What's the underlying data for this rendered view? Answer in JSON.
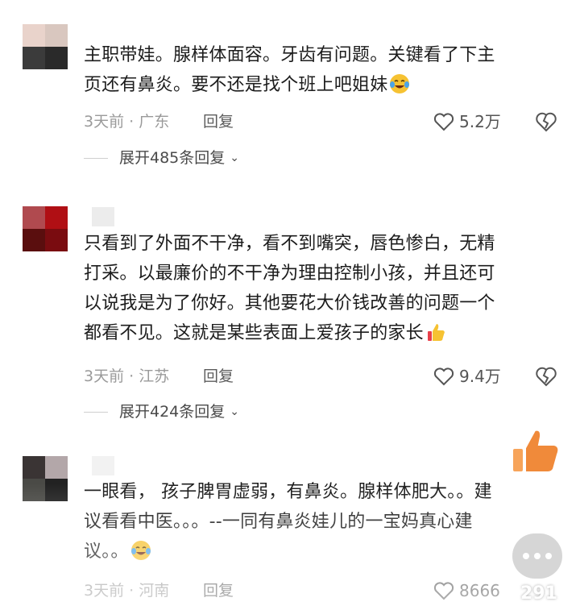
{
  "comments": [
    {
      "text_lines": [
        "主职带娃。腺样体面容。牙齿有问题。关键看了下主",
        "页还有鼻炎。要不还是找个班上吧姐妹"
      ],
      "emoji": "crying-laughing-emoji",
      "time_location": "3天前 · 广东",
      "reply_label": "回复",
      "likes": "5.2万",
      "expand_label": "展开485条回复",
      "avatar_colors": [
        "#e9d3cb",
        "#d9c7bf",
        "#3b3b3b",
        "#2a2a2a"
      ]
    },
    {
      "text_lines": [
        "只看到了外面不干净，看不到嘴突，唇色惨白，无精",
        "打采。以最廉价的不干净为理由控制小孩，并且还可",
        "以说我是为了你好。其他要花大价钱改善的问题一个",
        "都看不见。这就是某些表面上爱孩子的家长"
      ],
      "emoji": "thumbs-up-emoji",
      "time_location": "3天前 · 江苏",
      "reply_label": "回复",
      "likes": "9.4万",
      "expand_label": "展开424条回复",
      "avatar_colors": [
        "#b04a4f",
        "#b00f14",
        "#5a0e0e",
        "#7a0c10"
      ]
    },
    {
      "text_lines": [
        "一眼看， 孩子脾胃虚弱，有鼻炎。腺样体肥大。。建",
        "议看看中医。。。--一同有鼻炎娃儿的一宝妈真心建",
        "议。。"
      ],
      "emoji": "crying-laughing-emoji",
      "time_location": "3天前 · 河南",
      "reply_label": "回复",
      "likes": "8666",
      "avatar_colors": [
        "#3a3434",
        "#b3a7a9",
        "#4a4a46",
        "#222222"
      ]
    }
  ],
  "floating": {
    "comment_count": "291"
  },
  "colors": {
    "accent_orange": "#f08a3a",
    "emoji_yellow": "#f6c232"
  }
}
